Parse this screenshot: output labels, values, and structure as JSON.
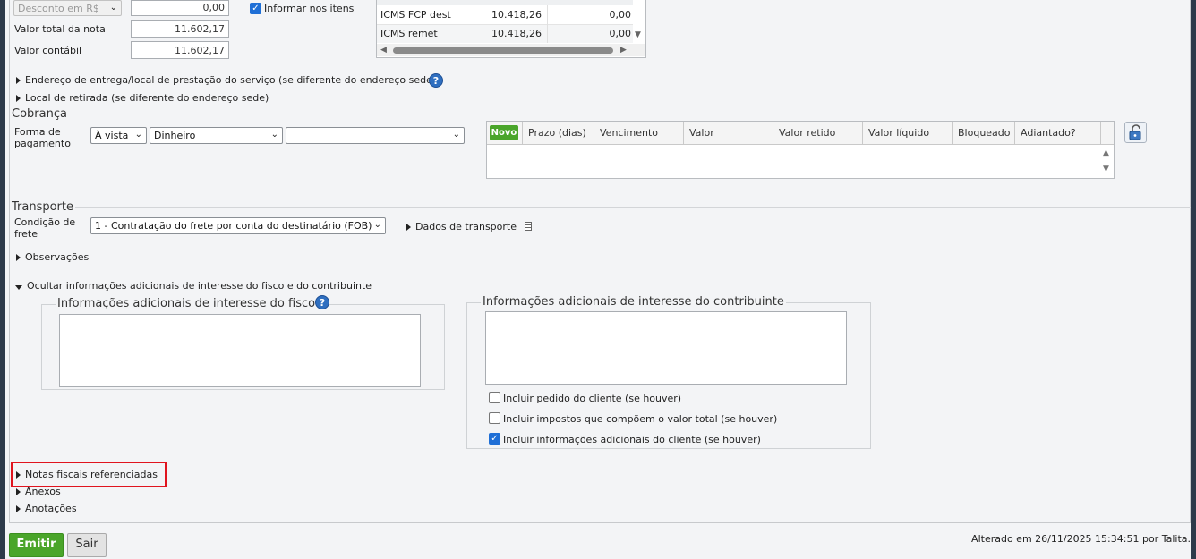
{
  "totals": {
    "discount_select": "Desconto em R$",
    "discount_value": "0,00",
    "total_label": "Valor total da nota",
    "total_value": "11.602,17",
    "accounting_label": "Valor contábil",
    "accounting_value": "11.602,17",
    "inform_items_label": "Informar nos itens",
    "inform_items_checked": true
  },
  "tax_table": {
    "rows": [
      {
        "name": "ICMS FCP dest",
        "base": "10.418,26",
        "value": "0,00"
      },
      {
        "name": "ICMS remet",
        "base": "10.418,26",
        "value": "0,00"
      }
    ]
  },
  "links": {
    "delivery_address": "Endereço de entrega/local de prestação do serviço (se diferente do endereço sede)",
    "pickup_location": "Local de retirada (se diferente do endereço sede)"
  },
  "cobranca": {
    "title": "Cobrança",
    "payment_label_1": "Forma de",
    "payment_label_2": "pagamento",
    "condition_select": "À vista",
    "method_select": "Dinheiro",
    "extra_select": "",
    "grid": {
      "new_button": "Novo",
      "columns": [
        "Prazo (dias)",
        "Vencimento",
        "Valor",
        "Valor retido",
        "Valor líquido",
        "Bloqueado",
        "Adiantado?"
      ]
    }
  },
  "transporte": {
    "title": "Transporte",
    "freight_label_1": "Condição de",
    "freight_label_2": "frete",
    "freight_select": "1 - Contratação do frete por conta do destinatário (FOB)",
    "transport_data_link": "Dados de transporte"
  },
  "observacoes": "Observações",
  "additional_info": {
    "toggle_label": "Ocultar informações adicionais de interesse do fisco e do contribuinte",
    "fisco_legend": "Informações adicionais de interesse do fisco",
    "contribuinte_legend": "Informações adicionais de interesse do contribuinte",
    "options": [
      {
        "label": "Incluir pedido do cliente (se houver)",
        "checked": false
      },
      {
        "label": "Incluir impostos que compõem o valor total (se houver)",
        "checked": false
      },
      {
        "label": "Incluir informações adicionais do cliente (se houver)",
        "checked": true
      }
    ]
  },
  "sections": {
    "referenced_invoices": "Notas fiscais referenciadas",
    "attachments": "Anexos",
    "annotations": "Anotações"
  },
  "footer": {
    "emit_button": "Emitir",
    "exit_button": "Sair",
    "status": "Alterado em 26/11/2025 15:34:51 por Talita."
  },
  "colors": {
    "accent_green": "#4aa52a",
    "highlight_red": "#e0141e",
    "checkbox_blue": "#1f6fd6"
  }
}
